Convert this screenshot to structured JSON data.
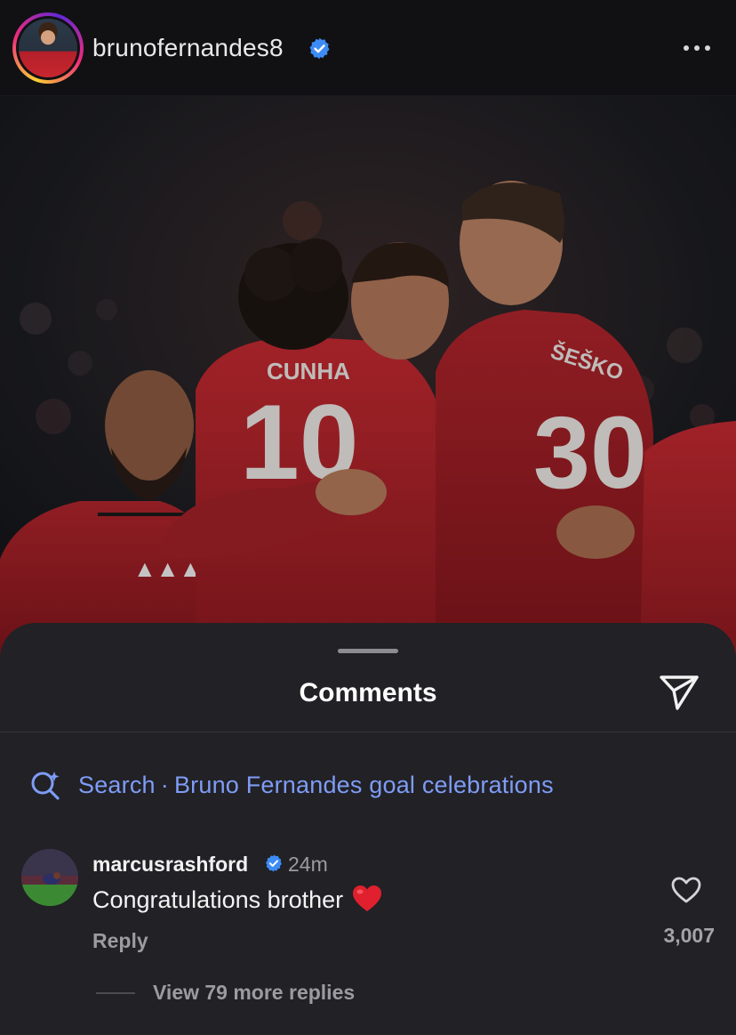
{
  "post": {
    "username": "brunofernandes8",
    "verified": true,
    "more_icon": "more-horizontal-icon"
  },
  "photo": {
    "jersey_names": [
      "CUNHA",
      "ŠEŠKO"
    ],
    "jersey_numbers": [
      "10",
      "30"
    ]
  },
  "comments_sheet": {
    "title": "Comments",
    "share_icon": "send-icon",
    "search": {
      "label": "Search",
      "separator": "·",
      "query": "Bruno Fernandes goal celebrations",
      "icon": "search-sparkle-icon"
    },
    "comments": [
      {
        "username": "marcusrashford",
        "verified": true,
        "time": "24m",
        "text": "Congratulations brother",
        "emoji": "red-heart",
        "reply_label": "Reply",
        "likes": "3,007",
        "view_replies": "View 79 more replies"
      }
    ]
  },
  "colors": {
    "background": "#0c0c0e",
    "sheet": "#212126",
    "verified": "#3d8bf5",
    "link": "#7f9cf5",
    "muted": "#9b9ba1",
    "heart": "#e0202e"
  }
}
